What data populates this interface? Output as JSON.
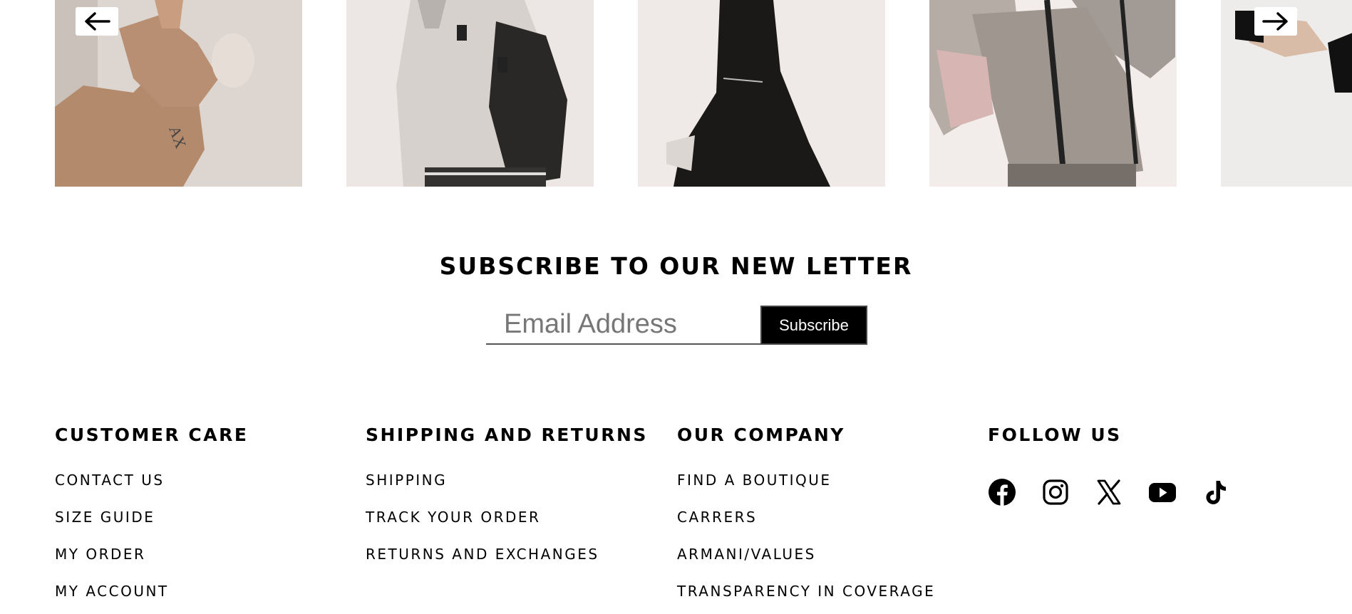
{
  "carousel": {
    "prev_icon": "arrow-left-icon",
    "next_icon": "arrow-right-icon",
    "images": [
      {
        "subject": "model-in-tan-teddy-coat"
      },
      {
        "subject": "model-in-grey-varsity-jacket"
      },
      {
        "subject": "model-in-black-dress"
      },
      {
        "subject": "model-in-grey-puffer-jacket"
      },
      {
        "subject": "model-in-black-top"
      }
    ]
  },
  "subscribe": {
    "title": "SUBSCRIBE TO OUR NEW LETTER",
    "email_placeholder": "Email Address",
    "email_value": "",
    "button_label": "Subscribe"
  },
  "footer": {
    "customer_care": {
      "title": "CUSTOMER CARE",
      "links": [
        "CONTACT US",
        "SIZE GUIDE",
        "MY ORDER",
        "MY ACCOUNT"
      ]
    },
    "shipping": {
      "title": "SHIPPING AND RETURNS",
      "links": [
        "SHIPPING",
        "TRACK YOUR ORDER",
        "RETURNS AND EXCHANGES"
      ]
    },
    "company": {
      "title": "OUR COMPANY",
      "links": [
        "FIND A BOUTIQUE",
        "CARRERS",
        "ARMANI/VALUES",
        "TRANSPARENCY IN COVERAGE"
      ]
    },
    "follow": {
      "title": "FOLLOW US",
      "icons": [
        "facebook-icon",
        "instagram-icon",
        "x-icon",
        "youtube-icon",
        "tiktok-icon"
      ]
    }
  },
  "colors": {
    "text": "#000000",
    "button_bg": "#000000",
    "button_text": "#ffffff",
    "photo_bg": "#ece6e3"
  }
}
